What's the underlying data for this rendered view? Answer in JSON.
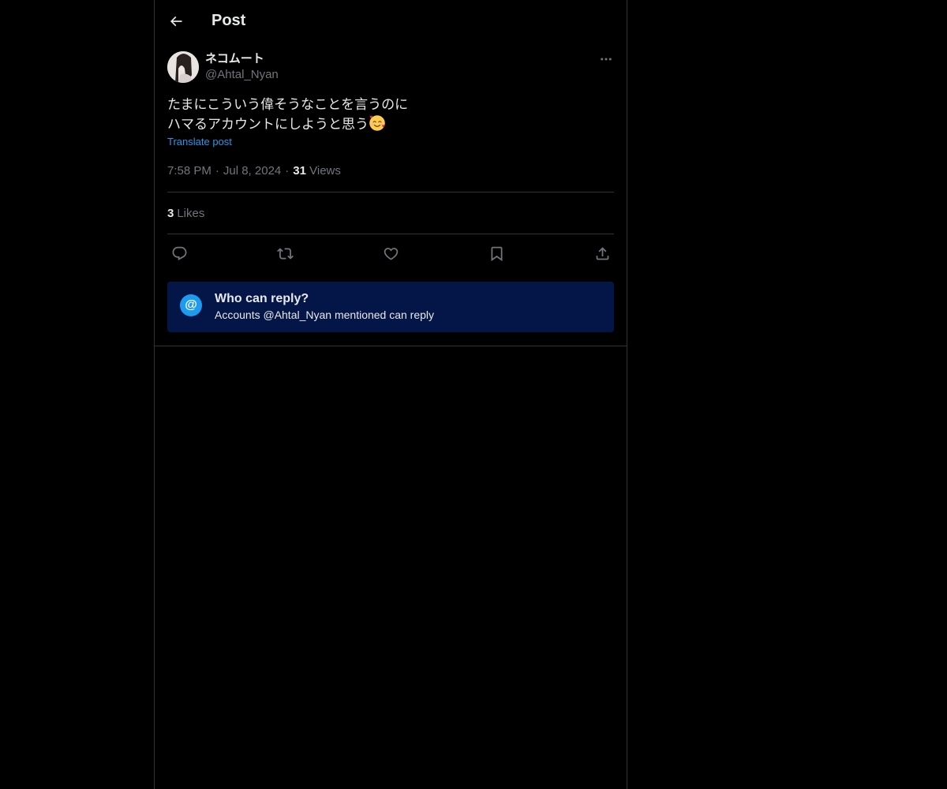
{
  "header": {
    "title": "Post",
    "back_icon": "arrow-left-icon"
  },
  "post": {
    "author": {
      "display_name": "ネコムート",
      "handle": "@Ahtal_Nyan"
    },
    "text_line1": "たまにこういう偉そうなことを言うのに",
    "text_line2": "ハマるアカウントにしようと思う",
    "emoji": "smiling-face-with-hearts-emoji",
    "translate_label": "Translate post",
    "time": "7:58 PM",
    "date": "Jul 8, 2024",
    "views_count": "31",
    "views_label": "Views",
    "likes_count": "3",
    "likes_label": "Likes"
  },
  "actions": [
    "reply-icon",
    "repost-icon",
    "like-icon",
    "bookmark-icon",
    "share-icon"
  ],
  "reply_restriction": {
    "icon_glyph": "@",
    "title": "Who can reply?",
    "subtitle": "Accounts @Ahtal_Nyan mentioned can reply"
  },
  "colors": {
    "background": "#000000",
    "text": "#e7e9ea",
    "muted": "#71767b",
    "accent": "#1d9bf0",
    "border": "#2f3336",
    "reply_box_bg": "#031647"
  }
}
